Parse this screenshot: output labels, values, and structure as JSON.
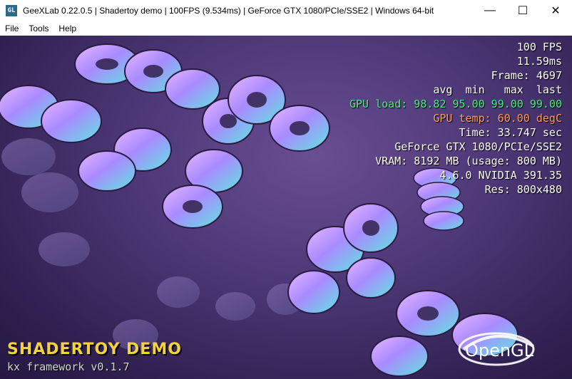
{
  "window": {
    "title": "GeeXLab 0.22.0.5 | Shadertoy demo | 100FPS (9.534ms) | GeForce GTX 1080/PCIe/SSE2 | Windows 64-bit",
    "icon": "geexlab-app-icon",
    "controls": {
      "minimize": "—",
      "maximize": "☐",
      "close": "✕"
    }
  },
  "menu": {
    "items": [
      "File",
      "Tools",
      "Help"
    ]
  },
  "hud": {
    "fps": "100 FPS",
    "frame_time": "11.59ms",
    "frame": "Frame: 4697",
    "stats_header": "avg  min   max  last",
    "gpu_load": "GPU load: 98.82 95.00 99.00 99.00",
    "gpu_temp": "GPU temp: 60.00 degC",
    "time": "Time: 33.747 sec",
    "gpu_name": "GeForce GTX 1080/PCIe/SSE2",
    "vram": "VRAM: 8192 MB (usage: 800 MB)",
    "gl_version": "4.6.0 NVIDIA 391.35",
    "resolution": "Res: 800x480"
  },
  "demo": {
    "title": "SHADERTOY DEMO",
    "subtitle": "kx framework v0.1.7"
  },
  "logo": {
    "text": "OpenGL"
  },
  "colors": {
    "gpu_load": "#46f07a",
    "gpu_temp": "#ff9a5a",
    "demo_title": "#f5d23a"
  }
}
